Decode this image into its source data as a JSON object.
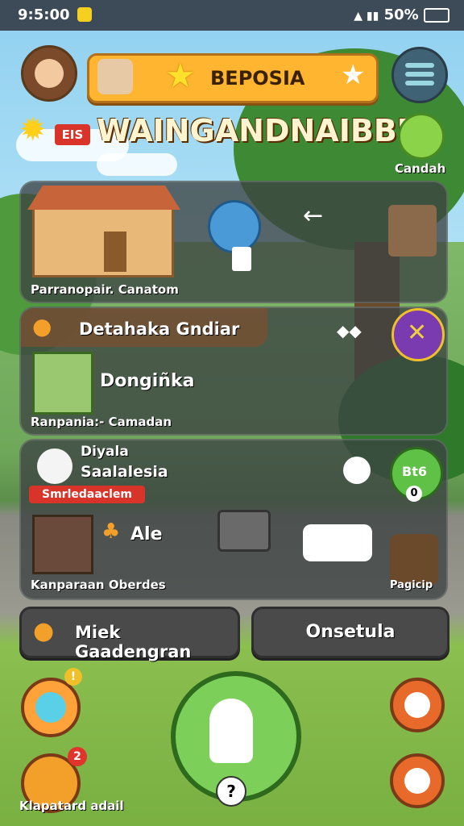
{
  "status_bar": {
    "time": "9:5:00",
    "indicators": "50%"
  },
  "header": {
    "banner_label": "BEPOSIA",
    "title": "WAINGANDNAIBBI",
    "badge_left": "EIS",
    "mascot_label": "Candah"
  },
  "panels": {
    "house": {
      "caption": "Parranopair. Canatom"
    },
    "quest": {
      "title": "Detahaka Gndiar",
      "name": "Dongiñka",
      "caption": "Ranpania:- Camadan"
    },
    "items": {
      "title_line1": "Diyala",
      "title_line2": "Saalalesia",
      "tag": "Smrledaaclem",
      "count": "Ale",
      "caption": "Kanparaan Oberdes",
      "bottle_label": "Bt6",
      "bottle_sub": "0",
      "plant_label": "Pagicip"
    }
  },
  "buttons": {
    "left": "Miek Gaadengran",
    "right": "Onsetula",
    "center_badge": "?"
  },
  "bottom": {
    "notif_top": "!",
    "notif_bottom": "2",
    "caption": "Klapatard adail"
  },
  "colors": {
    "accent": "#ffb530",
    "panel": "#3c4242",
    "green": "#5fc146"
  }
}
